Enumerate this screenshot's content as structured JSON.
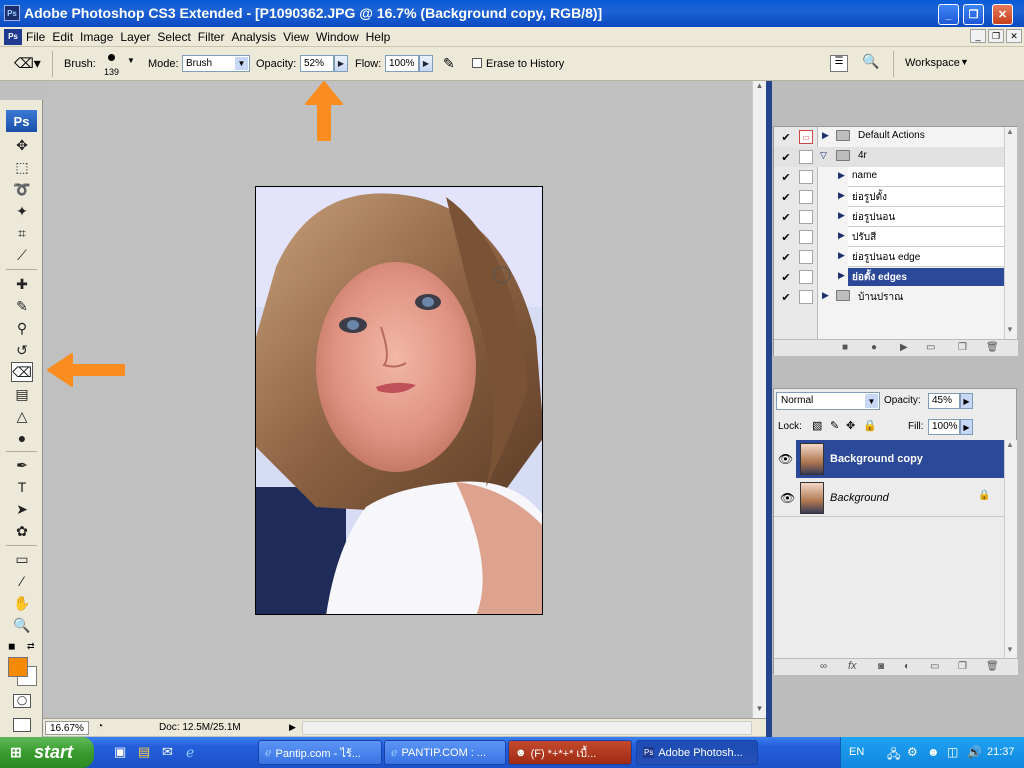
{
  "window": {
    "title": "Adobe Photoshop CS3 Extended - [P1090362.JPG @ 16.7% (Background copy, RGB/8)]",
    "app_icon": "Ps"
  },
  "menubar": {
    "items": [
      "File",
      "Edit",
      "Image",
      "Layer",
      "Select",
      "Filter",
      "Analysis",
      "View",
      "Window",
      "Help"
    ]
  },
  "options": {
    "brush_label": "Brush:",
    "brush_size": "139",
    "mode_label": "Mode:",
    "mode_value": "Brush",
    "opacity_label": "Opacity:",
    "opacity_value": "52%",
    "flow_label": "Flow:",
    "flow_value": "100%",
    "erase_history_label": "Erase to History",
    "workspace_label": "Workspace"
  },
  "toolbox": {
    "logo": "Ps",
    "tools": [
      "move-icon",
      "marquee-icon",
      "lasso-icon",
      "magic-wand-icon",
      "crop-icon",
      "slice-icon",
      "healing-icon",
      "brush-icon",
      "clone-stamp-icon",
      "history-brush-icon",
      "eraser-icon",
      "gradient-icon",
      "blur-icon",
      "dodge-icon",
      "pen-icon",
      "type-icon",
      "path-select-icon",
      "shape-icon",
      "notes-icon",
      "eyedropper-icon",
      "hand-icon",
      "zoom-icon"
    ],
    "foreground_color": "#f58a07",
    "background_color": "#ffffff"
  },
  "status": {
    "zoom": "16.67%",
    "doc": "Doc: 12.5M/25.1M"
  },
  "actions": {
    "rows": [
      {
        "label": "Default Actions",
        "type": "set",
        "expanded": false
      },
      {
        "label": "4r",
        "type": "set",
        "expanded": true
      },
      {
        "label": "name",
        "type": "action"
      },
      {
        "label": "ย่อรูปตั้ง",
        "type": "action"
      },
      {
        "label": "ย่อรูปนอน",
        "type": "action"
      },
      {
        "label": "ปรับสี",
        "type": "action"
      },
      {
        "label": "ย่อรูปนอน edge",
        "type": "action"
      },
      {
        "label": "ย่อตั้ง edges",
        "type": "action",
        "selected": true
      },
      {
        "label": "บ้านปราณ",
        "type": "set",
        "expanded": false
      }
    ]
  },
  "layers": {
    "blend_mode": "Normal",
    "opacity_label": "Opacity:",
    "opacity_value": "45%",
    "lock_label": "Lock:",
    "fill_label": "Fill:",
    "fill_value": "100%",
    "items": [
      {
        "name": "Background copy",
        "selected": true
      },
      {
        "name": "Background",
        "locked": true
      }
    ]
  },
  "taskbar": {
    "start_label": "start",
    "buttons": [
      "Pantip.com - ไร้...",
      "PANTIP.COM : ...",
      "(F) *+*+* เบื้...",
      "Adobe Photosh..."
    ],
    "language": "EN",
    "clock": "21:37"
  },
  "annotation_color": "#fb8c1f"
}
